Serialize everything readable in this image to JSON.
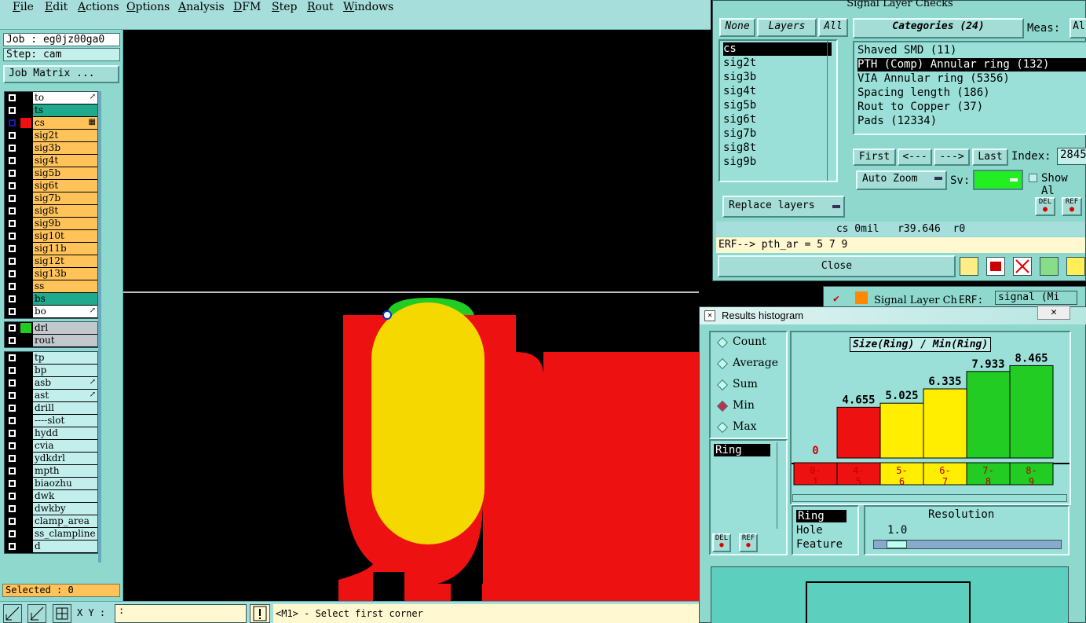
{
  "menu": [
    "File",
    "Edit",
    "Actions",
    "Options",
    "Analysis",
    "DFM",
    "Step",
    "Rout",
    "Windows"
  ],
  "left": {
    "job": "Job : eg0jz00ga0",
    "step": "Step: cam",
    "job_matrix": "Job Matrix ...",
    "group1": [
      {
        "name": "to",
        "color": "#ffffff",
        "swatch": "#000000",
        "mark": "↗"
      },
      {
        "name": "ts",
        "color": "#1fa98d",
        "swatch": "#000000",
        "mark": ""
      },
      {
        "name": "cs",
        "color": "#ffc35a",
        "swatch": "#ee1111",
        "mark": "▦",
        "active": true
      },
      {
        "name": "sig2t",
        "color": "#ffc35a",
        "swatch": "#000000",
        "mark": ""
      },
      {
        "name": "sig3b",
        "color": "#ffc35a",
        "swatch": "#000000",
        "mark": ""
      },
      {
        "name": "sig4t",
        "color": "#ffc35a",
        "swatch": "#000000",
        "mark": ""
      },
      {
        "name": "sig5b",
        "color": "#ffc35a",
        "swatch": "#000000",
        "mark": ""
      },
      {
        "name": "sig6t",
        "color": "#ffc35a",
        "swatch": "#000000",
        "mark": ""
      },
      {
        "name": "sig7b",
        "color": "#ffc35a",
        "swatch": "#000000",
        "mark": ""
      },
      {
        "name": "sig8t",
        "color": "#ffc35a",
        "swatch": "#000000",
        "mark": ""
      },
      {
        "name": "sig9b",
        "color": "#ffc35a",
        "swatch": "#000000",
        "mark": ""
      },
      {
        "name": "sig10t",
        "color": "#ffc35a",
        "swatch": "#000000",
        "mark": ""
      },
      {
        "name": "sig11b",
        "color": "#ffc35a",
        "swatch": "#000000",
        "mark": ""
      },
      {
        "name": "sig12t",
        "color": "#ffc35a",
        "swatch": "#000000",
        "mark": ""
      },
      {
        "name": "sig13b",
        "color": "#ffc35a",
        "swatch": "#000000",
        "mark": ""
      },
      {
        "name": "ss",
        "color": "#ffc35a",
        "swatch": "#000000",
        "mark": ""
      },
      {
        "name": "bs",
        "color": "#1fa98d",
        "swatch": "#000000",
        "mark": ""
      },
      {
        "name": "bo",
        "color": "#ffffff",
        "swatch": "#000000",
        "mark": "↗"
      }
    ],
    "group2": [
      {
        "name": "drl",
        "color": "#c2c8cc",
        "swatch": "#22cc22",
        "mark": ""
      },
      {
        "name": "rout",
        "color": "#c2c8cc",
        "swatch": "#000000",
        "mark": ""
      }
    ],
    "group3": [
      {
        "name": "tp",
        "color": "#c2eeec",
        "swatch": "#000000",
        "mark": ""
      },
      {
        "name": "bp",
        "color": "#c2eeec",
        "swatch": "#000000",
        "mark": ""
      },
      {
        "name": "asb",
        "color": "#c2eeec",
        "swatch": "#000000",
        "mark": "↗"
      },
      {
        "name": "ast",
        "color": "#c2eeec",
        "swatch": "#000000",
        "mark": "↗"
      },
      {
        "name": "drill",
        "color": "#c2eeec",
        "swatch": "#000000",
        "mark": ""
      },
      {
        "name": "----slot",
        "color": "#c2eeec",
        "swatch": "#000000",
        "mark": ""
      },
      {
        "name": "hydd",
        "color": "#c2eeec",
        "swatch": "#000000",
        "mark": ""
      },
      {
        "name": "cvia",
        "color": "#c2eeec",
        "swatch": "#000000",
        "mark": ""
      },
      {
        "name": "ydkdrl",
        "color": "#c2eeec",
        "swatch": "#000000",
        "mark": ""
      },
      {
        "name": "mpth",
        "color": "#c2eeec",
        "swatch": "#000000",
        "mark": ""
      },
      {
        "name": "biaozhu",
        "color": "#c2eeec",
        "swatch": "#000000",
        "mark": ""
      },
      {
        "name": "dwk",
        "color": "#c2eeec",
        "swatch": "#000000",
        "mark": ""
      },
      {
        "name": "dwkby",
        "color": "#c2eeec",
        "swatch": "#000000",
        "mark": ""
      },
      {
        "name": "clamp_area",
        "color": "#c2eeec",
        "swatch": "#000000",
        "mark": ""
      },
      {
        "name": "ss_clampline",
        "color": "#c2eeec",
        "swatch": "#000000",
        "mark": ""
      },
      {
        "name": "d",
        "color": "#c2eeec",
        "swatch": "#000000",
        "mark": ""
      }
    ],
    "selected": "Selected : 0"
  },
  "bottom": {
    "xy_label": "X Y :",
    "xy_value": ":",
    "status": "<M1> - Select first corner"
  },
  "slc": {
    "title": "Signal Layer Checks",
    "none_btn": "None",
    "layers_btn": "Layers",
    "all_btn": "All",
    "layers": [
      "cs",
      "sig2t",
      "sig3b",
      "sig4t",
      "sig5b",
      "sig6t",
      "sig7b",
      "sig8t",
      "sig9b"
    ],
    "categories_btn": "Categories (24)",
    "meas_label": "Meas:",
    "meas_value": "Al",
    "categories": [
      "Shaved SMD (11)",
      "PTH (Comp) Annular ring (132)",
      "VIA Annular ring (5356)",
      "Spacing length (186)",
      "Rout to Copper (37)",
      "Pads (12334)"
    ],
    "first_btn": "First",
    "prev_btn": "<---",
    "next_btn": "--->",
    "last_btn": "Last",
    "index_label": "Index:",
    "index_value": "2845",
    "auto_zoom": "Auto Zoom",
    "sv_label": "Sv:",
    "show_all": "Show Al",
    "del": "DEL",
    "ref": "REF",
    "replace_layers": "Replace layers",
    "info_line": "cs 0mil   r39.646  r0",
    "erf_line": "ERF--> pth_ar = 5 7 9",
    "close_btn": "Close"
  },
  "behind": {
    "title": "Signal Layer Ch",
    "erf": "ERF:",
    "signal": "signal (Mi"
  },
  "hist": {
    "title": "Results histogram",
    "radios": [
      "Count",
      "Average",
      "Sum",
      "Min",
      "Max"
    ],
    "selected_radio": "Min",
    "list_item": "Ring",
    "chart_title": "Size(Ring) / Min(Ring)",
    "ring": "Ring",
    "hole": "Hole",
    "feature": "Feature",
    "resolution_label": "Resolution",
    "resolution_value": "1.0",
    "del": "DEL",
    "ref": "REF"
  },
  "chart_data": {
    "type": "bar",
    "title": "Size(Ring) / Min(Ring)",
    "categories": [
      "0-1",
      "4-5",
      "5-6",
      "6-7",
      "7-8",
      "8-9"
    ],
    "values": [
      0,
      4.655,
      5.025,
      6.335,
      7.933,
      8.465
    ],
    "value_labels": [
      "0",
      "4.655",
      "5.025",
      "6.335",
      "7.933",
      "8.465"
    ],
    "bin_labels": [
      [
        "0-",
        "1"
      ],
      [
        "4-",
        "5"
      ],
      [
        "5-",
        "6"
      ],
      [
        "6-",
        "7"
      ],
      [
        "7-",
        "8"
      ],
      [
        "8-",
        "9"
      ]
    ],
    "colors": [
      "#ee1111",
      "#ee1111",
      "#ffee00",
      "#ffee00",
      "#22cc22",
      "#22cc22"
    ]
  }
}
